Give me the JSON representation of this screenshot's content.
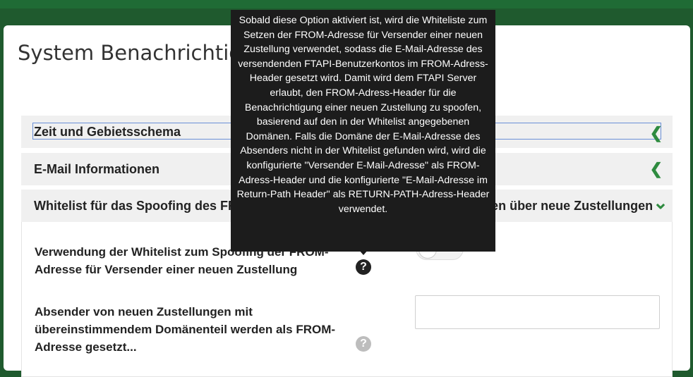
{
  "modal": {
    "title": "System Benachrichtigungen"
  },
  "panels": [
    {
      "title": "Zeit und Gebietsschema",
      "state": "collapsed",
      "icon": "chevron-left-icon"
    },
    {
      "title": "E-Mail Informationen",
      "state": "collapsed",
      "icon": "chevron-left-icon"
    },
    {
      "title": "Whitelist für das Spoofing des FROM-Adress-Headers für Benachrichtigungen über neue Zustellungen",
      "state": "expanded",
      "icon": "chevron-down-icon"
    }
  ],
  "settings": {
    "whitelist_label": "Verwendung der Whitelist zum Spoofing der FROM-Adresse für Versender einer neuen Zustellung",
    "whitelist_toggle": false,
    "sender_label": "Absender von neuen Zustellungen mit übereinstimmendem Domänenteil werden als FROM-Adresse gesetzt...",
    "sender_value": ""
  },
  "icons": {
    "help": "?",
    "chevron_left": "❮",
    "chevron_down": "⌄"
  },
  "tooltip": {
    "text": "Sobald diese Option aktiviert ist, wird die Whiteliste zum Setzen der FROM-Adresse für Versender einer neuen Zustellung verwendet, sodass die E-Mail-Adresse des versendenden FTAPI-Benutzerkontos im FROM-Adress-Header gesetzt wird. Damit wird dem FTAPI Server erlaubt, den FROM-Adress-Header für die Benachrichtigung einer neuen Zustellung zu spoofen, basierend auf den in der Whitelist angegebenen Domänen. Falls die Domäne der E-Mail-Adresse des Absenders nicht in der Whitelist gefunden wird, wird die konfigurierte \"Versender E-Mail-Adresse\" als FROM-Adress-Header und die konfigurierte \"E-Mail-Adresse im Return-Path Header\" als RETURN-PATH-Adress-Header verwendet."
  },
  "colors": {
    "accent": "#2e8b3f",
    "header_bar": "#1f6b35",
    "tooltip_bg": "#1c1c1c",
    "panel_bg": "#f0f0f0"
  }
}
